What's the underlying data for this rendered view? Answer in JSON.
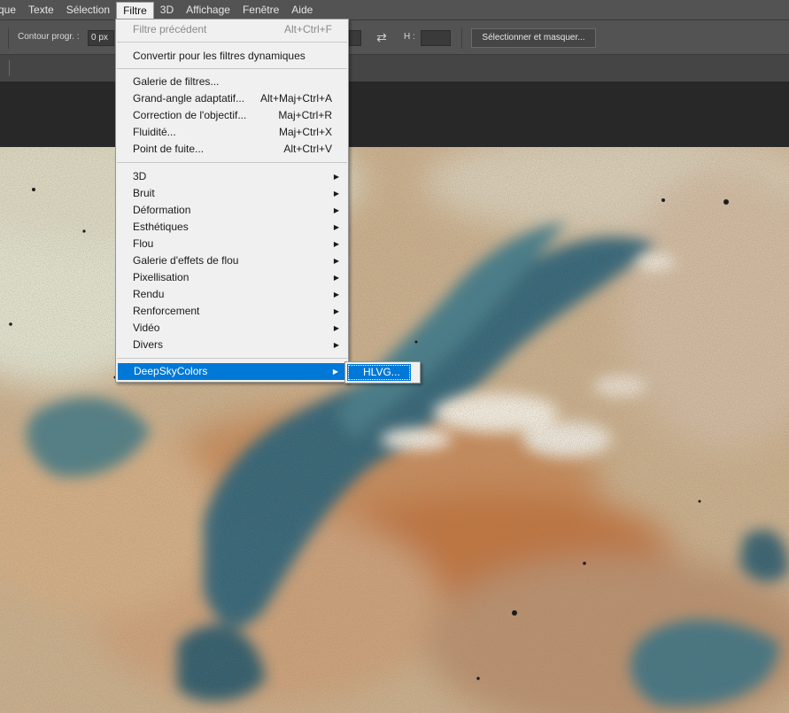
{
  "menubar": {
    "items": [
      {
        "label": "que"
      },
      {
        "label": "Texte"
      },
      {
        "label": "Sélection"
      },
      {
        "label": "Filtre"
      },
      {
        "label": "3D"
      },
      {
        "label": "Affichage"
      },
      {
        "label": "Fenêtre"
      },
      {
        "label": "Aide"
      }
    ]
  },
  "options": {
    "feather_label": "Contour progr. :",
    "feather_value": "0 px",
    "height_label": "H :",
    "height_value": "",
    "select_mask_label": "Sélectionner et masquer...",
    "swap_icon": "swap-arrows-icon"
  },
  "filter_menu": {
    "items": [
      {
        "label": "Filtre précédent",
        "shortcut": "Alt+Ctrl+F",
        "disabled": true
      },
      {
        "label": "Convertir pour les filtres dynamiques",
        "shortcut": ""
      },
      {
        "label": "Galerie de filtres...",
        "shortcut": ""
      },
      {
        "label": "Grand-angle adaptatif...",
        "shortcut": "Alt+Maj+Ctrl+A"
      },
      {
        "label": "Correction de l'objectif...",
        "shortcut": "Maj+Ctrl+R"
      },
      {
        "label": "Fluidité...",
        "shortcut": "Maj+Ctrl+X"
      },
      {
        "label": "Point de fuite...",
        "shortcut": "Alt+Ctrl+V"
      },
      {
        "label": "3D",
        "submenu": true
      },
      {
        "label": "Bruit",
        "submenu": true
      },
      {
        "label": "Déformation",
        "submenu": true
      },
      {
        "label": "Esthétiques",
        "submenu": true
      },
      {
        "label": "Flou",
        "submenu": true
      },
      {
        "label": "Galerie d'effets de flou",
        "submenu": true
      },
      {
        "label": "Pixellisation",
        "submenu": true
      },
      {
        "label": "Rendu",
        "submenu": true
      },
      {
        "label": "Renforcement",
        "submenu": true
      },
      {
        "label": "Vidéo",
        "submenu": true
      },
      {
        "label": "Divers",
        "submenu": true
      },
      {
        "label": "DeepSkyColors",
        "submenu": true,
        "highlighted": true
      }
    ],
    "submenu_arrow": "▶"
  },
  "submenu": {
    "items": [
      {
        "label": "HLVG..."
      }
    ]
  },
  "colors": {
    "highlight": "#0078d7",
    "menu_bg": "#f0f0f0",
    "toolbar_bg": "#535353"
  }
}
